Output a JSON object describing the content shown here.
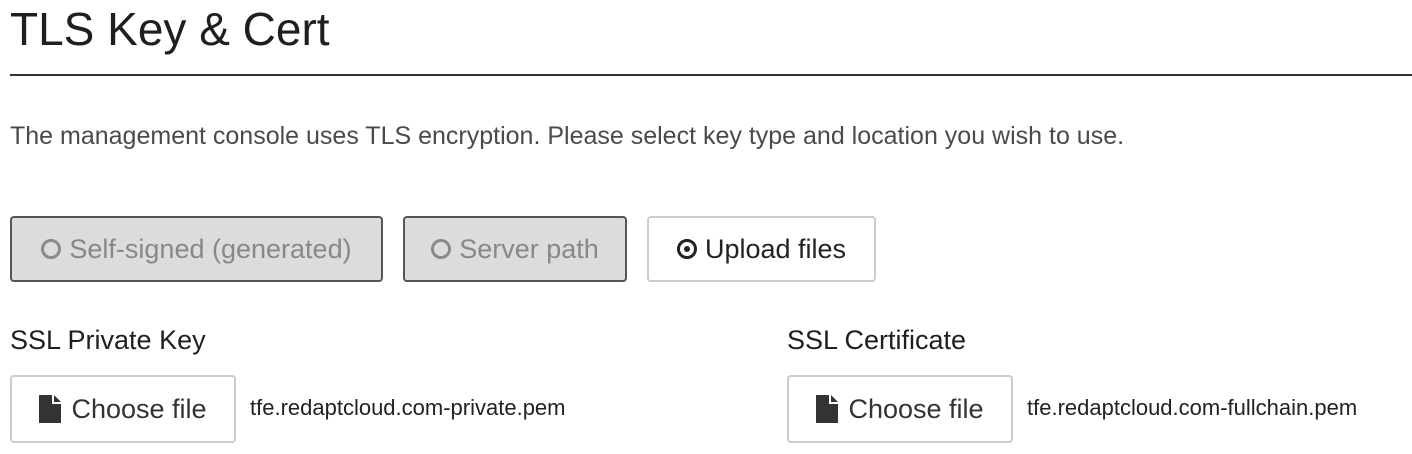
{
  "page": {
    "title": "TLS Key & Cert",
    "intro": "The management console uses TLS encryption. Please select key type and location you wish to use."
  },
  "key_type": {
    "options": [
      {
        "label": "Self-signed (generated)",
        "selected": false,
        "disabled": true
      },
      {
        "label": "Server path",
        "selected": false,
        "disabled": true
      },
      {
        "label": "Upload files",
        "selected": true,
        "disabled": false
      }
    ]
  },
  "private_key": {
    "label": "SSL Private Key",
    "button_label": "Choose file",
    "file_name": "tfe.redaptcloud.com-private.pem"
  },
  "certificate": {
    "label": "SSL Certificate",
    "button_label": "Choose file",
    "file_name": "tfe.redaptcloud.com-fullchain.pem"
  },
  "icons": {
    "radio_unselected": "radio-unchecked-icon",
    "radio_selected": "radio-checked-icon",
    "file": "file-icon"
  },
  "colors": {
    "disabled_bg": "#dcdcdc",
    "disabled_text": "#888888",
    "text": "#222222",
    "divider": "#333333"
  }
}
